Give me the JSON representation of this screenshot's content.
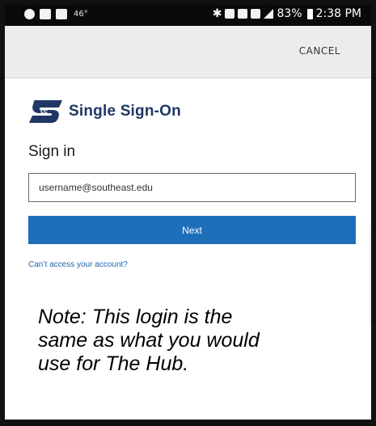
{
  "status_bar": {
    "temperature": "46°",
    "battery": "83%",
    "time": "2:38 PM",
    "icons_left": [
      "blocked-icon",
      "image-icon",
      "mail-icon"
    ],
    "icons_right": [
      "bluetooth-icon",
      "alarm-icon",
      "wifi-icon",
      "4g-icon",
      "signal-icon",
      "battery-icon"
    ]
  },
  "header": {
    "cancel_label": "CANCEL"
  },
  "brand": {
    "title": "Single Sign-On",
    "logo_icon": "sso-logo-icon",
    "logo_color": "#1f3763"
  },
  "form": {
    "heading": "Sign in",
    "username_value": "username@southeast.edu",
    "next_label": "Next",
    "help_link": "Can’t access your account?",
    "button_color": "#1e6fba"
  },
  "note": {
    "line1": "Note: This login is the",
    "line2": "same as what you would",
    "line3": "use for The Hub."
  }
}
